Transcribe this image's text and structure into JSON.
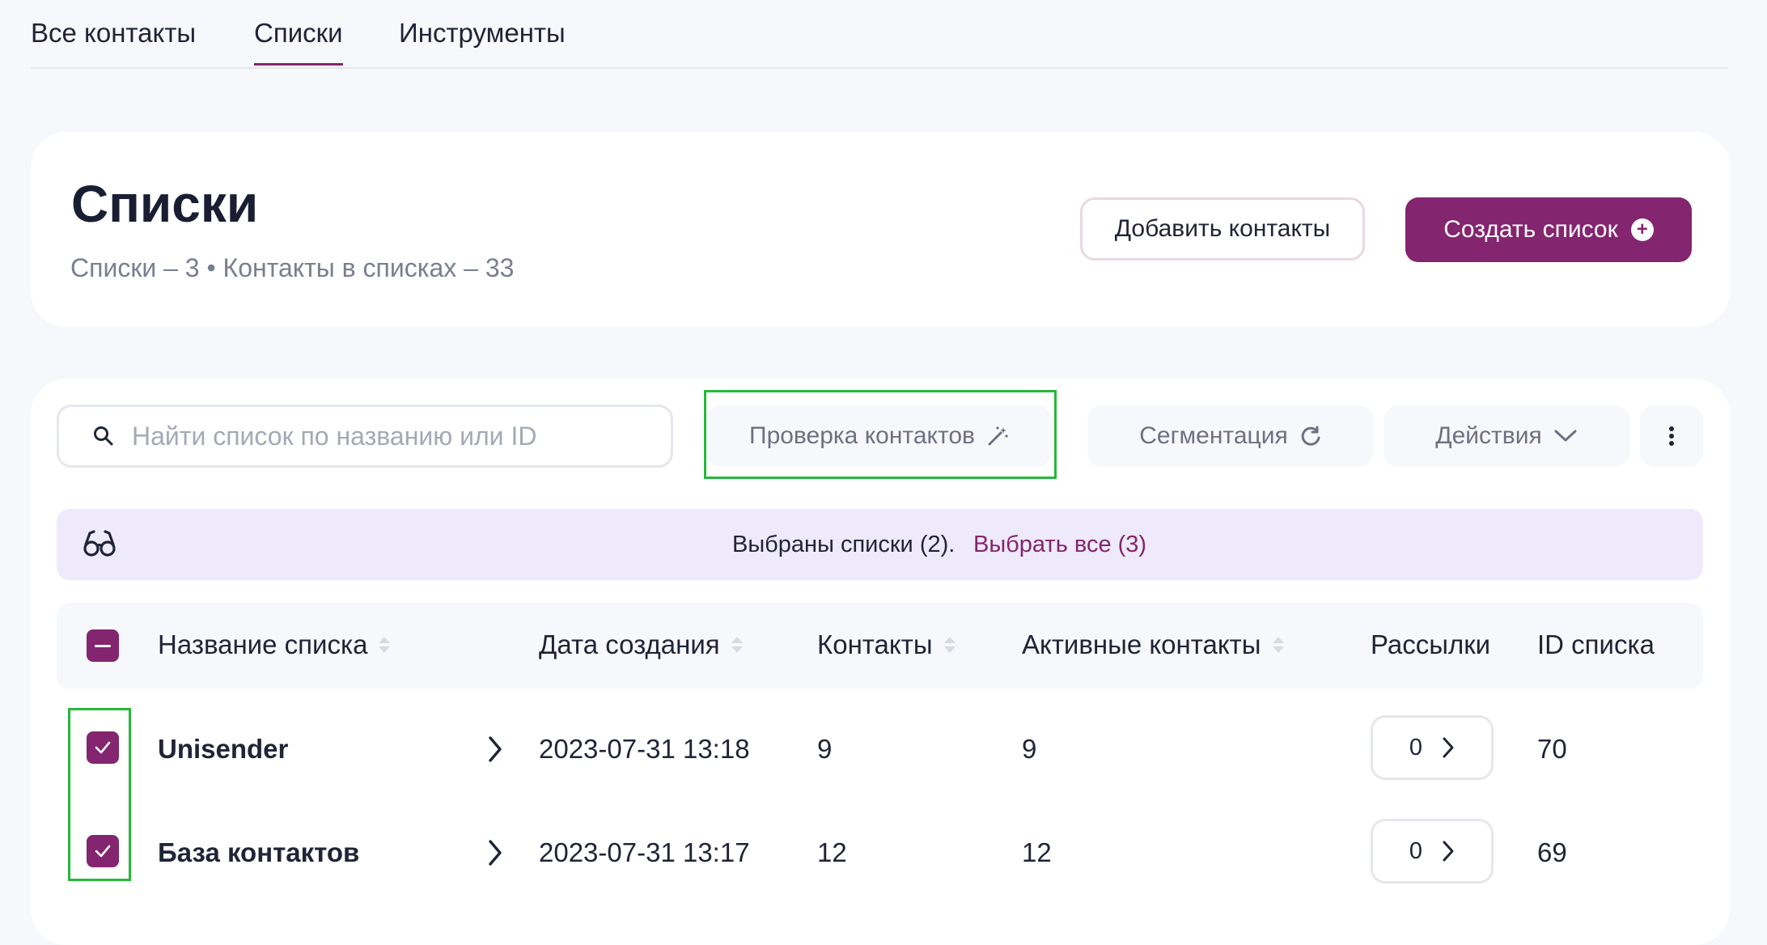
{
  "tabs": [
    {
      "label": "Все контакты"
    },
    {
      "label": "Списки"
    },
    {
      "label": "Инструменты"
    }
  ],
  "header": {
    "title": "Списки",
    "subtitle": "Списки – 3 • Контакты в списках – 33",
    "add_contacts_label": "Добавить контакты",
    "create_list_label": "Создать список"
  },
  "toolbar": {
    "search_placeholder": "Найти список по названию или ID",
    "check_contacts_label": "Проверка контактов",
    "segmentation_label": "Сегментация",
    "actions_label": "Действия"
  },
  "selection_banner": {
    "text": "Выбраны списки (2).",
    "select_all_label": "Выбрать все (3)"
  },
  "table": {
    "columns": [
      "Название списка",
      "Дата создания",
      "Контакты",
      "Активные контакты",
      "Рассылки",
      "ID списка"
    ],
    "rows": [
      {
        "name": "Unisender",
        "created": "2023-07-31 13:18",
        "contacts": "9",
        "active": "9",
        "mailings": "0",
        "id": "70"
      },
      {
        "name": "База контактов",
        "created": "2023-07-31 13:17",
        "contacts": "12",
        "active": "12",
        "mailings": "0",
        "id": "69"
      }
    ]
  },
  "colors": {
    "accent": "#84256f",
    "highlight": "#25b83a",
    "banner_bg": "#eeeafc",
    "page_bg": "#f7f8fb"
  },
  "icons": [
    "search-icon",
    "magic-wand-icon",
    "refresh-icon",
    "chevron-down-icon",
    "more-vertical-icon",
    "glasses-icon",
    "plus-circle-icon",
    "chevron-right-icon",
    "checkmark-icon"
  ]
}
